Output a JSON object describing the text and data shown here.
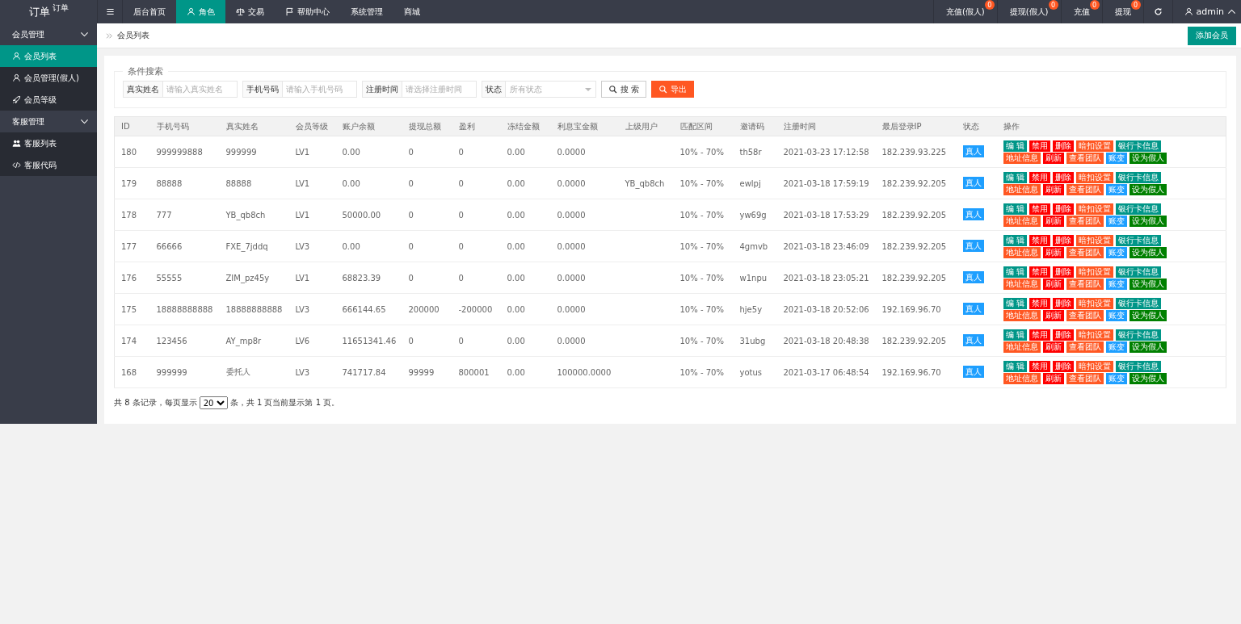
{
  "logo": {
    "title": "订单",
    "sup": "订单"
  },
  "nav": {
    "tabs": [
      {
        "label": "后台首页",
        "selected": false
      },
      {
        "label": "角色",
        "selected": true
      },
      {
        "label": "交易",
        "selected": false
      },
      {
        "label": "帮助中心",
        "selected": false
      },
      {
        "label": "系统管理",
        "selected": false
      },
      {
        "label": "商城",
        "selected": false
      }
    ],
    "right": [
      {
        "label": "充值(假人)",
        "badge": "0"
      },
      {
        "label": "提现(假人)",
        "badge": "0"
      },
      {
        "label": "充值",
        "badge": "0"
      },
      {
        "label": "提现",
        "badge": "0"
      }
    ],
    "user": "admin"
  },
  "sidebar": {
    "groups": [
      {
        "label": "会员管理",
        "expanded": true,
        "items": [
          {
            "label": "会员列表",
            "selected": true
          },
          {
            "label": "会员管理(假人)",
            "selected": false
          },
          {
            "label": "会员等级",
            "selected": false
          }
        ]
      },
      {
        "label": "客服管理",
        "expanded": true,
        "items": [
          {
            "label": "客服列表",
            "selected": false
          },
          {
            "label": "客服代码",
            "selected": false
          }
        ]
      }
    ]
  },
  "breadcrumb": "会员列表",
  "add_button": "添加会员",
  "search": {
    "legend": "条件搜索",
    "fields": [
      {
        "kind": "text",
        "label": "真实姓名",
        "placeholder": "请输入真实姓名"
      },
      {
        "kind": "text",
        "label": "手机号码",
        "placeholder": "请输入手机号码"
      },
      {
        "kind": "text",
        "label": "注册时间",
        "placeholder": "请选择注册时间"
      },
      {
        "kind": "select",
        "label": "状态",
        "value": "所有状态"
      }
    ],
    "search_button": "搜 索",
    "export_button": "导出"
  },
  "table": {
    "columns": [
      "ID",
      "手机号码",
      "真实姓名",
      "会员等级",
      "账户余额",
      "提现总额",
      "盈利",
      "冻结金额",
      "利息宝金额",
      "上级用户",
      "匹配区间",
      "邀请码",
      "注册时间",
      "最后登录IP",
      "状态",
      "操作"
    ],
    "rows": [
      {
        "id": "180",
        "phone": "999999888",
        "name": "999999",
        "level": "LV1",
        "balance": "0.00",
        "withdraw": "0",
        "profit": "0",
        "frozen": "0.00",
        "interest": "0.0000",
        "range": "10% - 70%",
        "invite": "th58r",
        "reg_time": "2021-03-23 17:12:58",
        "ip": "182.239.93.225",
        "status": "真人",
        "actions": [
          [
            {
              "label": "编 辑",
              "kind": "primary"
            },
            {
              "label": "禁用",
              "kind": "danger"
            },
            {
              "label": "删除",
              "kind": "danger"
            },
            {
              "label": "暗扣设置",
              "kind": "warm"
            },
            {
              "label": "银行卡信息",
              "kind": "primary"
            }
          ],
          [
            {
              "label": "地址信息",
              "kind": "warm"
            },
            {
              "label": "刷新",
              "kind": "danger"
            },
            {
              "label": "查看团队",
              "kind": "warm"
            },
            {
              "label": "账变",
              "kind": "info"
            },
            {
              "label": "设为假人",
              "kind": "success"
            }
          ]
        ]
      },
      {
        "id": "179",
        "phone": "88888",
        "name": "88888",
        "level": "LV1",
        "balance": "0.00",
        "withdraw": "0",
        "profit": "0",
        "frozen": "0.00",
        "interest": "0.0000",
        "parent": "YB_qb8ch",
        "range": "10% - 70%",
        "invite": "ewlpj",
        "reg_time": "2021-03-18 17:59:19",
        "ip": "182.239.92.205",
        "status": "真人",
        "actions": [
          [
            {
              "label": "编 辑",
              "kind": "primary"
            },
            {
              "label": "禁用",
              "kind": "danger"
            },
            {
              "label": "删除",
              "kind": "danger"
            },
            {
              "label": "暗扣设置",
              "kind": "warm"
            },
            {
              "label": "银行卡信息",
              "kind": "primary"
            }
          ],
          [
            {
              "label": "地址信息",
              "kind": "warm"
            },
            {
              "label": "刷新",
              "kind": "danger"
            },
            {
              "label": "查看团队",
              "kind": "warm"
            },
            {
              "label": "账变",
              "kind": "info"
            },
            {
              "label": "设为假人",
              "kind": "success"
            }
          ]
        ]
      },
      {
        "id": "178",
        "phone": "777",
        "name": "YB_qb8ch",
        "level": "LV1",
        "balance": "50000.00",
        "withdraw": "0",
        "profit": "0",
        "frozen": "0.00",
        "interest": "0.0000",
        "range": "10% - 70%",
        "invite": "yw69g",
        "reg_time": "2021-03-18 17:53:29",
        "ip": "182.239.92.205",
        "status": "真人",
        "actions": [
          [
            {
              "label": "编 辑",
              "kind": "primary"
            },
            {
              "label": "禁用",
              "kind": "danger"
            },
            {
              "label": "删除",
              "kind": "danger"
            },
            {
              "label": "暗扣设置",
              "kind": "warm"
            },
            {
              "label": "银行卡信息",
              "kind": "primary"
            }
          ],
          [
            {
              "label": "地址信息",
              "kind": "warm"
            },
            {
              "label": "刷新",
              "kind": "danger"
            },
            {
              "label": "查看团队",
              "kind": "warm"
            },
            {
              "label": "账变",
              "kind": "info"
            },
            {
              "label": "设为假人",
              "kind": "success"
            }
          ]
        ]
      },
      {
        "id": "177",
        "phone": "66666",
        "name": "FXE_7jddq",
        "level": "LV3",
        "balance": "0.00",
        "withdraw": "0",
        "profit": "0",
        "frozen": "0.00",
        "interest": "0.0000",
        "range": "10% - 70%",
        "invite": "4gmvb",
        "reg_time": "2021-03-18 23:46:09",
        "ip": "182.239.92.205",
        "status": "真人",
        "actions": [
          [
            {
              "label": "编 辑",
              "kind": "primary"
            },
            {
              "label": "禁用",
              "kind": "danger"
            },
            {
              "label": "删除",
              "kind": "danger"
            },
            {
              "label": "暗扣设置",
              "kind": "warm"
            },
            {
              "label": "银行卡信息",
              "kind": "primary"
            }
          ],
          [
            {
              "label": "地址信息",
              "kind": "warm"
            },
            {
              "label": "刷新",
              "kind": "danger"
            },
            {
              "label": "查看团队",
              "kind": "warm"
            },
            {
              "label": "账变",
              "kind": "info"
            },
            {
              "label": "设为假人",
              "kind": "success"
            }
          ]
        ]
      },
      {
        "id": "176",
        "phone": "55555",
        "name": "ZIM_pz45y",
        "level": "LV1",
        "balance": "68823.39",
        "withdraw": "0",
        "profit": "0",
        "frozen": "0.00",
        "interest": "0.0000",
        "range": "10% - 70%",
        "invite": "w1npu",
        "reg_time": "2021-03-18 23:05:21",
        "ip": "182.239.92.205",
        "status": "真人",
        "actions": [
          [
            {
              "label": "编 辑",
              "kind": "primary"
            },
            {
              "label": "禁用",
              "kind": "danger"
            },
            {
              "label": "删除",
              "kind": "danger"
            },
            {
              "label": "暗扣设置",
              "kind": "warm"
            },
            {
              "label": "银行卡信息",
              "kind": "primary"
            }
          ],
          [
            {
              "label": "地址信息",
              "kind": "warm"
            },
            {
              "label": "刷新",
              "kind": "danger"
            },
            {
              "label": "查看团队",
              "kind": "warm"
            },
            {
              "label": "账变",
              "kind": "info"
            },
            {
              "label": "设为假人",
              "kind": "success"
            }
          ]
        ]
      },
      {
        "id": "175",
        "phone": "18888888888",
        "name": "18888888888",
        "level": "LV3",
        "balance": "666144.65",
        "withdraw": "200000",
        "profit": "-200000",
        "frozen": "0.00",
        "interest": "0.0000",
        "range": "10% - 70%",
        "invite": "hje5y",
        "reg_time": "2021-03-18 20:52:06",
        "ip": "192.169.96.70",
        "status": "真人",
        "actions": [
          [
            {
              "label": "编 辑",
              "kind": "primary"
            },
            {
              "label": "禁用",
              "kind": "danger"
            },
            {
              "label": "删除",
              "kind": "danger"
            },
            {
              "label": "暗扣设置",
              "kind": "warm"
            },
            {
              "label": "银行卡信息",
              "kind": "primary"
            }
          ],
          [
            {
              "label": "地址信息",
              "kind": "warm"
            },
            {
              "label": "刷新",
              "kind": "danger"
            },
            {
              "label": "查看团队",
              "kind": "warm"
            },
            {
              "label": "账变",
              "kind": "info"
            },
            {
              "label": "设为假人",
              "kind": "success"
            }
          ]
        ]
      },
      {
        "id": "174",
        "phone": "123456",
        "name": "AY_mp8r",
        "level": "LV6",
        "balance": "11651341.46",
        "withdraw": "0",
        "profit": "0",
        "frozen": "0.00",
        "interest": "0.0000",
        "range": "10% - 70%",
        "invite": "31ubg",
        "reg_time": "2021-03-18 20:48:38",
        "ip": "182.239.92.205",
        "status": "真人",
        "actions": [
          [
            {
              "label": "编 辑",
              "kind": "primary"
            },
            {
              "label": "禁用",
              "kind": "danger"
            },
            {
              "label": "删除",
              "kind": "danger"
            },
            {
              "label": "暗扣设置",
              "kind": "warm"
            },
            {
              "label": "银行卡信息",
              "kind": "primary"
            }
          ],
          [
            {
              "label": "地址信息",
              "kind": "warm"
            },
            {
              "label": "刷新",
              "kind": "danger"
            },
            {
              "label": "查看团队",
              "kind": "warm"
            },
            {
              "label": "账变",
              "kind": "info"
            },
            {
              "label": "设为假人",
              "kind": "success"
            }
          ]
        ]
      },
      {
        "id": "168",
        "phone": "999999",
        "name": "委托人",
        "level": "LV3",
        "balance": "741717.84",
        "withdraw": "99999",
        "profit": "800001",
        "frozen": "0.00",
        "interest": "100000.0000",
        "range": "10% - 70%",
        "invite": "yotus",
        "reg_time": "2021-03-17 06:48:54",
        "ip": "192.169.96.70",
        "status": "真人",
        "actions": [
          [
            {
              "label": "编 辑",
              "kind": "primary"
            },
            {
              "label": "禁用",
              "kind": "danger"
            },
            {
              "label": "删除",
              "kind": "danger"
            },
            {
              "label": "暗扣设置",
              "kind": "warm"
            },
            {
              "label": "银行卡信息",
              "kind": "primary"
            }
          ],
          [
            {
              "label": "地址信息",
              "kind": "warm"
            },
            {
              "label": "刷新",
              "kind": "danger"
            },
            {
              "label": "查看团队",
              "kind": "warm"
            },
            {
              "label": "账变",
              "kind": "info"
            },
            {
              "label": "设为假人",
              "kind": "success"
            }
          ]
        ]
      }
    ]
  },
  "pagination": {
    "before": "共 8 条记录，每页显示",
    "page_size": "20",
    "after": "条，共 1 页当前显示第 1 页。"
  }
}
